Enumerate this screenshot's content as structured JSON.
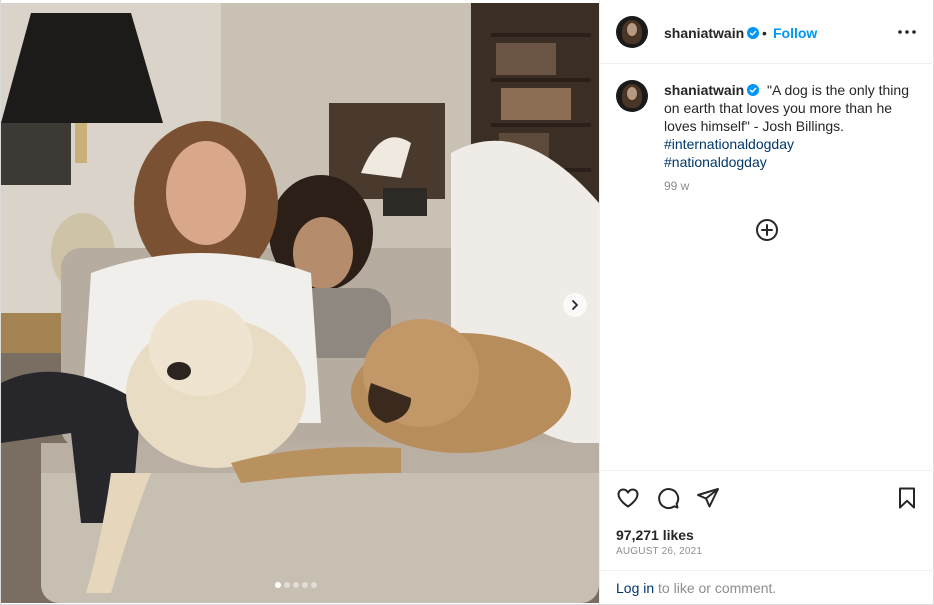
{
  "post": {
    "image_description_alt": "",
    "carousel": {
      "total": 5,
      "active_index": 0
    }
  },
  "header": {
    "username": "shaniatwain",
    "separator": "•",
    "follow_label": "Follow"
  },
  "caption": {
    "username": "shaniatwain",
    "text": "\"A dog is the only thing on earth that loves you more than he loves himself\" - Josh Billings.",
    "hashtags": [
      "#internationaldogday",
      "#nationaldogday"
    ],
    "age": "99 w"
  },
  "engagement": {
    "likes": "97,271 likes",
    "date": "AUGUST 26, 2021"
  },
  "footer": {
    "login_label": "Log in",
    "rest": " to like or comment."
  },
  "icons": {
    "verified": "verified-badge-icon",
    "more": "more-options-icon",
    "add": "plus-circle-icon",
    "like": "heart-icon",
    "comment": "comment-icon",
    "share": "share-icon",
    "save": "bookmark-icon",
    "next": "chevron-right-icon"
  },
  "colors": {
    "accent": "#0095f6",
    "link": "#00376b",
    "muted": "#8e8e8e",
    "text": "#262626",
    "verified": "#0095f6"
  }
}
